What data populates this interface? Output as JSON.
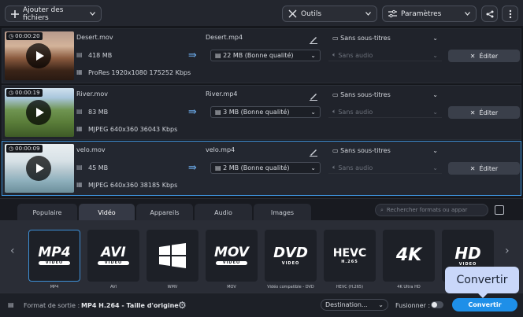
{
  "toolbar": {
    "add_files": "Ajouter des fichiers",
    "tools": "Outils",
    "settings": "Paramètres"
  },
  "files": [
    {
      "duration": "00:00:20",
      "name": "Desert.mov",
      "size": "418 MB",
      "meta": "ProRes 1920x1080 175252 Kbps",
      "output_name": "Desert.mp4",
      "output_size": "22 MB (Bonne qualité)",
      "subtitles": "Sans sous-titres",
      "audio": "Sans audio",
      "edit": "Éditer"
    },
    {
      "duration": "00:00:19",
      "name": "River.mov",
      "size": "83 MB",
      "meta": "MJPEG 640x360 36043 Kbps",
      "output_name": "River.mp4",
      "output_size": "3 MB (Bonne qualité)",
      "subtitles": "Sans sous-titres",
      "audio": "Sans audio",
      "edit": "Éditer"
    },
    {
      "duration": "00:00:09",
      "name": "velo.mov",
      "size": "45 MB",
      "meta": "MJPEG 640x360 38185 Kbps",
      "output_name": "velo.mp4",
      "output_size": "2 MB (Bonne qualité)",
      "subtitles": "Sans sous-titres",
      "audio": "Sans audio",
      "edit": "Éditer"
    }
  ],
  "tabs": [
    "Populaire",
    "Vidéo",
    "Appareils",
    "Audio",
    "Images"
  ],
  "active_tab": "Vidéo",
  "search_placeholder": "Rechercher formats ou appar",
  "formats": [
    {
      "logo": "MP4",
      "sub": "VIDEO",
      "label": "MP4"
    },
    {
      "logo": "AVI",
      "sub": "VIDEO",
      "label": "AVI"
    },
    {
      "logo": "",
      "sub": "",
      "label": "WMV"
    },
    {
      "logo": "MOV",
      "sub": "VIDEO",
      "label": "MOV"
    },
    {
      "logo": "DVD",
      "sub": "VIDEO",
      "label": "Vidéo compatible - DVD"
    },
    {
      "logo": "HEVC",
      "sub": "H.265",
      "label": "HEVC (H.265)"
    },
    {
      "logo": "4K",
      "sub": "",
      "label": "4K Ultra HD"
    },
    {
      "logo": "HD",
      "sub": "VIDEO",
      "label": ""
    }
  ],
  "bottom": {
    "output_label": "Format de sortie :",
    "output_value": "MP4 H.264 - Taille d'origine",
    "destination": "Destination...",
    "merge": "Fusionner :",
    "convert": "Convertir",
    "tooltip": "Convertir"
  },
  "colors": {
    "accent": "#1e8fe8",
    "selection": "#3d8fd6"
  }
}
